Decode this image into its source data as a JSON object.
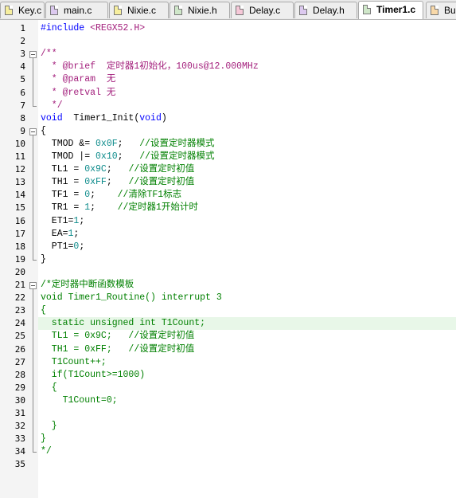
{
  "tabs": [
    {
      "label": "Key.c",
      "color": "yellow",
      "active": false
    },
    {
      "label": "main.c",
      "color": "purple",
      "active": false
    },
    {
      "label": "Nixie.c",
      "color": "yellow",
      "active": false
    },
    {
      "label": "Nixie.h",
      "color": "green",
      "active": false
    },
    {
      "label": "Delay.c",
      "color": "pink",
      "active": false
    },
    {
      "label": "Delay.h",
      "color": "purple",
      "active": false
    },
    {
      "label": "Timer1.c",
      "color": "green",
      "active": true
    },
    {
      "label": "Bu",
      "color": "orange",
      "active": false
    }
  ],
  "current_line": 24,
  "lines": [
    {
      "n": "1",
      "t": [
        [
          "kw",
          "#include "
        ],
        [
          "str",
          "<REGX52.H>"
        ]
      ]
    },
    {
      "n": "2",
      "t": []
    },
    {
      "n": "3",
      "t": [
        [
          "doc",
          "/**"
        ]
      ]
    },
    {
      "n": "4",
      "t": [
        [
          "doc",
          "  * @brief  定时器1初始化，100us@12.000MHz"
        ]
      ]
    },
    {
      "n": "5",
      "t": [
        [
          "doc",
          "  * @param  无"
        ]
      ]
    },
    {
      "n": "6",
      "t": [
        [
          "doc",
          "  * @retval 无"
        ]
      ]
    },
    {
      "n": "7",
      "t": [
        [
          "doc",
          "  */"
        ]
      ]
    },
    {
      "n": "8",
      "t": [
        [
          "ty",
          "void"
        ],
        [
          "",
          "  Timer1_Init("
        ],
        [
          "ty",
          "void"
        ],
        [
          "",
          ")"
        ]
      ]
    },
    {
      "n": "9",
      "t": [
        [
          "",
          "{"
        ]
      ]
    },
    {
      "n": "10",
      "t": [
        [
          "",
          "  TMOD &= "
        ],
        [
          "num",
          "0x0F"
        ],
        [
          "",
          ";   "
        ],
        [
          "cmt",
          "//设置定时器模式"
        ]
      ]
    },
    {
      "n": "11",
      "t": [
        [
          "",
          "  TMOD |= "
        ],
        [
          "num",
          "0x10"
        ],
        [
          "",
          ";   "
        ],
        [
          "cmt",
          "//设置定时器模式"
        ]
      ]
    },
    {
      "n": "12",
      "t": [
        [
          "",
          "  TL1 = "
        ],
        [
          "num",
          "0x9C"
        ],
        [
          "",
          ";   "
        ],
        [
          "cmt",
          "//设置定时初值"
        ]
      ]
    },
    {
      "n": "13",
      "t": [
        [
          "",
          "  TH1 = "
        ],
        [
          "num",
          "0xFF"
        ],
        [
          "",
          ";   "
        ],
        [
          "cmt",
          "//设置定时初值"
        ]
      ]
    },
    {
      "n": "14",
      "t": [
        [
          "",
          "  TF1 = "
        ],
        [
          "num",
          "0"
        ],
        [
          "",
          ";    "
        ],
        [
          "cmt",
          "//清除TF1标志"
        ]
      ]
    },
    {
      "n": "15",
      "t": [
        [
          "",
          "  TR1 = "
        ],
        [
          "num",
          "1"
        ],
        [
          "",
          ";    "
        ],
        [
          "cmt",
          "//定时器1开始计时"
        ]
      ]
    },
    {
      "n": "16",
      "t": [
        [
          "",
          "  ET1="
        ],
        [
          "num",
          "1"
        ],
        [
          "",
          ";"
        ]
      ]
    },
    {
      "n": "17",
      "t": [
        [
          "",
          "  EA="
        ],
        [
          "num",
          "1"
        ],
        [
          "",
          ";"
        ]
      ]
    },
    {
      "n": "18",
      "t": [
        [
          "",
          "  PT1="
        ],
        [
          "num",
          "0"
        ],
        [
          "",
          ";"
        ]
      ]
    },
    {
      "n": "19",
      "t": [
        [
          "",
          "}"
        ]
      ]
    },
    {
      "n": "20",
      "t": []
    },
    {
      "n": "21",
      "t": [
        [
          "cmt",
          "/*定时器中断函数模板"
        ]
      ]
    },
    {
      "n": "22",
      "t": [
        [
          "cmt",
          "void Timer1_Routine() interrupt 3"
        ]
      ]
    },
    {
      "n": "23",
      "t": [
        [
          "cmt",
          "{"
        ]
      ]
    },
    {
      "n": "24",
      "t": [
        [
          "cmt",
          "  static unsigned int T1Count;"
        ]
      ]
    },
    {
      "n": "25",
      "t": [
        [
          "cmt",
          "  TL1 = 0x9C;   //设置定时初值"
        ]
      ]
    },
    {
      "n": "26",
      "t": [
        [
          "cmt",
          "  TH1 = 0xFF;   //设置定时初值"
        ]
      ]
    },
    {
      "n": "27",
      "t": [
        [
          "cmt",
          "  T1Count++;"
        ]
      ]
    },
    {
      "n": "28",
      "t": [
        [
          "cmt",
          "  if(T1Count>=1000)"
        ]
      ]
    },
    {
      "n": "29",
      "t": [
        [
          "cmt",
          "  {"
        ]
      ]
    },
    {
      "n": "30",
      "t": [
        [
          "cmt",
          "    T1Count=0;"
        ]
      ]
    },
    {
      "n": "31",
      "t": []
    },
    {
      "n": "32",
      "t": [
        [
          "cmt",
          "  }"
        ]
      ]
    },
    {
      "n": "33",
      "t": [
        [
          "cmt",
          "}"
        ]
      ]
    },
    {
      "n": "34",
      "t": [
        [
          "cmt",
          "*/"
        ]
      ]
    },
    {
      "n": "35",
      "t": []
    }
  ],
  "folds": [
    3,
    9,
    21
  ]
}
